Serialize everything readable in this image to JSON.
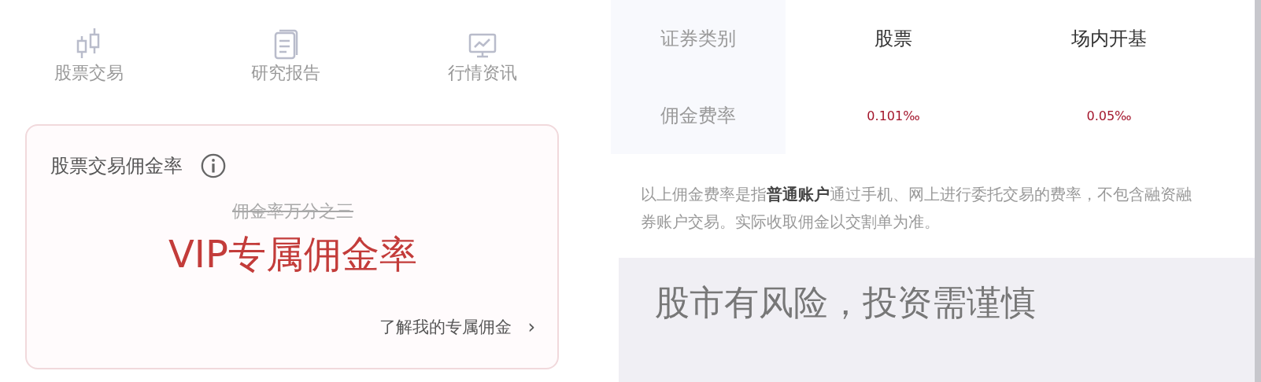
{
  "nav_items": [
    {
      "label": "股票交易",
      "kind": "candles"
    },
    {
      "label": "研究报告",
      "kind": "document"
    },
    {
      "label": "行情资讯",
      "kind": "monitor"
    }
  ],
  "commission_card": {
    "title": "股票交易佣金率",
    "old_rate": "佣金率万分之三",
    "headline": "VIP专属佣金率",
    "link": "了解我的专属佣金",
    "link_arrow": "›"
  },
  "rate_table": {
    "columns": [
      "证券类别",
      "股票",
      "场内开基"
    ],
    "rows": [
      {
        "label": "佣金费率",
        "values": [
          "0.101‰",
          "0.05‰"
        ]
      }
    ]
  },
  "note": "以上佣金费率是指**普通账户**通过手机、网上进行委托交易的费率，不包含融资融券账户交易。实际收取佣金以交割单为准。",
  "risk_banner": "股市有风险，投资需谨慎"
}
